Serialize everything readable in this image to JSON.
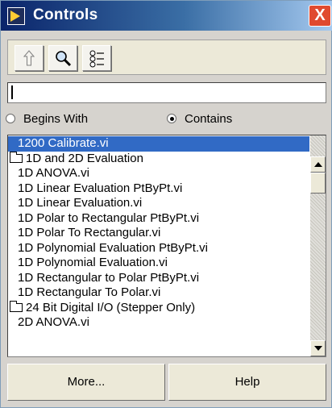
{
  "window": {
    "title": "Controls",
    "close_label": "X"
  },
  "toolbar": {
    "buttons": [
      {
        "name": "up",
        "icon": "up-arrow-icon"
      },
      {
        "name": "search",
        "icon": "magnifier-icon"
      },
      {
        "name": "options",
        "icon": "list-options-icon"
      }
    ]
  },
  "search": {
    "value": ""
  },
  "radios": [
    {
      "label": "Begins With",
      "checked": false
    },
    {
      "label": "Contains",
      "checked": true
    }
  ],
  "list": {
    "items": [
      {
        "label": "1200 Calibrate.vi",
        "type": "vi",
        "selected": true
      },
      {
        "label": "1D and 2D Evaluation",
        "type": "folder",
        "selected": false
      },
      {
        "label": "1D ANOVA.vi",
        "type": "vi",
        "selected": false
      },
      {
        "label": "1D Linear Evaluation PtByPt.vi",
        "type": "vi",
        "selected": false
      },
      {
        "label": "1D Linear Evaluation.vi",
        "type": "vi",
        "selected": false
      },
      {
        "label": "1D Polar to Rectangular PtByPt.vi",
        "type": "vi",
        "selected": false
      },
      {
        "label": "1D Polar To Rectangular.vi",
        "type": "vi",
        "selected": false
      },
      {
        "label": "1D Polynomial Evaluation PtByPt.vi",
        "type": "vi",
        "selected": false
      },
      {
        "label": "1D Polynomial Evaluation.vi",
        "type": "vi",
        "selected": false
      },
      {
        "label": "1D Rectangular to Polar PtByPt.vi",
        "type": "vi",
        "selected": false
      },
      {
        "label": "1D Rectangular To Polar.vi",
        "type": "vi",
        "selected": false
      },
      {
        "label": "24 Bit Digital I/O (Stepper Only)",
        "type": "folder",
        "selected": false
      },
      {
        "label": "2D ANOVA.vi",
        "type": "vi",
        "selected": false
      }
    ]
  },
  "buttons": {
    "more": "More...",
    "help": "Help"
  },
  "colors": {
    "title_bar": "#0a246a",
    "selection": "#316ac5",
    "close": "#e04a2f"
  }
}
